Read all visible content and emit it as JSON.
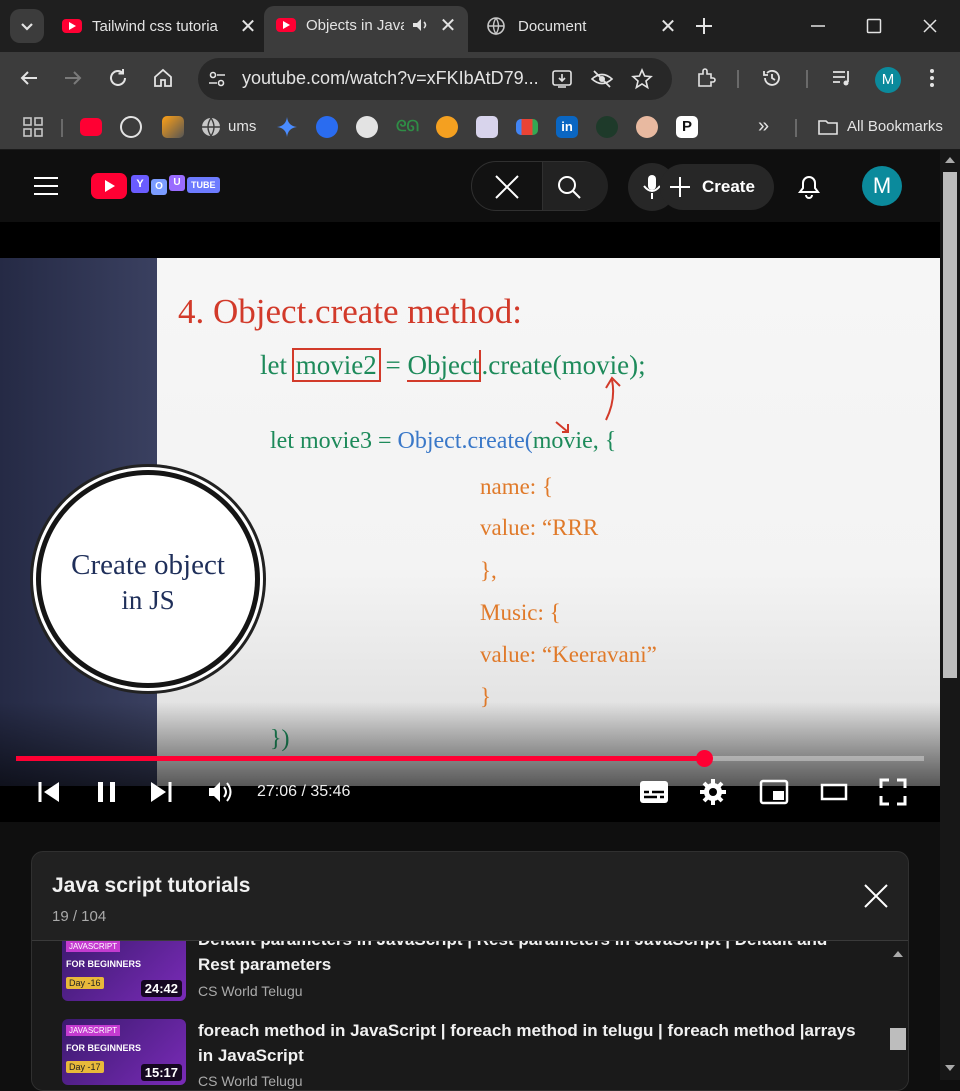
{
  "browser": {
    "tabs": [
      {
        "title": "Tailwind css tutoria",
        "favicon": "youtube-icon"
      },
      {
        "title": "Objects in Java",
        "favicon": "youtube-icon",
        "active": true,
        "audio": true
      },
      {
        "title": "Document",
        "favicon": "globe-icon"
      }
    ],
    "url": "youtube.com/watch?v=xFKIbAtD79...",
    "bookmarks": [
      {
        "label": "ums",
        "icon": "globe-icon"
      },
      {
        "label": "All Bookmarks",
        "icon": "folder-icon"
      }
    ],
    "profile_initial": "M"
  },
  "youtube": {
    "logo_text": [
      "Y",
      "O",
      "U",
      "TUBE"
    ],
    "create_label": "Create",
    "avatar_initial": "M"
  },
  "video": {
    "slide": {
      "heading": "4. Object.create method:",
      "line1": [
        "let ",
        "movie2",
        " = ",
        "Object",
        ".create(movie);"
      ],
      "line2": [
        "let movie3  = ",
        "Object.create(",
        "movie, {"
      ],
      "line3": "name: {",
      "line4": "value: “RRR",
      "line5": "},",
      "line6": "Music: {",
      "line7": "value: “Keeravani”",
      "line8": "}",
      "line9": "})",
      "badge_line1": "Create object",
      "badge_line2": "in JS"
    },
    "time": "27:06 / 35:46",
    "progress": 0.758,
    "accent": "#ff0033"
  },
  "playlist": {
    "title": "Java script tutorials",
    "position": "19 / 104",
    "items": [
      {
        "title": "Default parameters in JavaScript | Rest parameters in JavaScript | Default and Rest parameters",
        "channel": "CS World Telugu",
        "duration": "24:42",
        "thumb_tag": "JAVASCRIPT",
        "thumb_sub": "FOR BEGINNERS",
        "thumb_day": "Day -16"
      },
      {
        "title": "foreach method in JavaScript | foreach method in telugu | foreach method |arrays in JavaScript",
        "channel": "CS World Telugu",
        "duration": "15:17",
        "thumb_tag": "JAVASCRIPT",
        "thumb_sub": "FOR BEGINNERS",
        "thumb_day": "Day -17"
      }
    ]
  }
}
